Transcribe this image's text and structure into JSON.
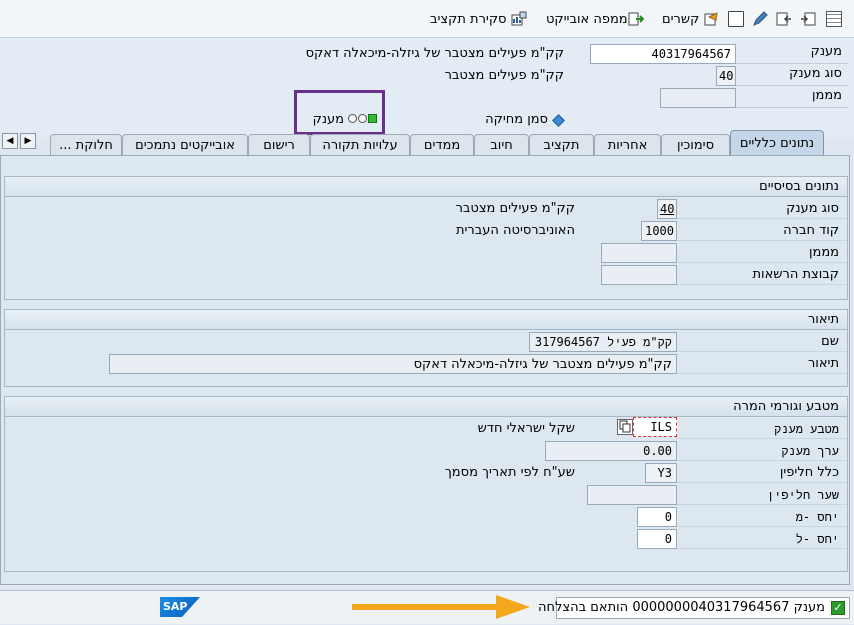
{
  "toolbar": {
    "relationships": "קשרים",
    "object_map": "ממפה אובייקט",
    "budget_review": "סקירת תקציב"
  },
  "header": {
    "customer_label": "מענק",
    "customer_value": "40317964567",
    "customer_desc": "קק\"מ פעילים מצטבר של גיזלה-מיכאלה דאקס",
    "type_label": "סוג מענק",
    "type_value": "40",
    "type_desc": "קק\"מ פעילים מצטבר",
    "funder_label": "מממן",
    "funder_value": "",
    "delete_flag_label": "סמן מחיקה",
    "status_label": "מענק"
  },
  "tabs": [
    {
      "label": "נתונים כלליים"
    },
    {
      "label": "סימוכין"
    },
    {
      "label": "אחריות"
    },
    {
      "label": "תקציב"
    },
    {
      "label": "חיוב"
    },
    {
      "label": "ממדים"
    },
    {
      "label": "עלויות תקורה"
    },
    {
      "label": "רישום"
    },
    {
      "label": "אובייקטים נתמכים"
    },
    {
      "label": "חלוקת ..."
    }
  ],
  "basic": {
    "title": "נתונים בסיסיים",
    "type_label": "סוג מענק",
    "type_value": "40",
    "type_desc": "קק\"מ פעילים מצטבר",
    "company_label": "קוד חברה",
    "company_value": "1000",
    "company_desc": "האוניברסיטה העברית",
    "funder_label": "מממן",
    "funder_value": "",
    "auth_group_label": "קבוצת הרשאות",
    "auth_group_value": ""
  },
  "description": {
    "title": "תיאור",
    "name_label": "שם",
    "name_value": "קק\"מ פעיל 317964567",
    "desc_label": "תיאור",
    "desc_value": "קק\"מ פעילים מצטבר של גיזלה-מיכאלה דאקס"
  },
  "currency": {
    "title": "מטבע וגורמי המרה",
    "currency_label": "מטבע מענק",
    "currency_value": "ILS",
    "currency_desc": "שקל ישראלי חדש",
    "value_label": "ערך מענק",
    "value_value": "0.00",
    "rule_label": "כלל חליפין",
    "rule_value": "Y3",
    "rule_desc": "שע\"ח לפי תאריך מסמך",
    "rate_label": "שער חליפין",
    "rate_value": "",
    "from_ratio_label": "יחס -מ",
    "from_ratio_value": "0",
    "to_ratio_label": "יחס -ל",
    "to_ratio_value": "0"
  },
  "status": {
    "message": "מענק 0000000040317964567 הותאם בהצלחה",
    "logo": "SAP"
  },
  "colors": {
    "highlight_box": "#6a2f8a",
    "arrow": "#f2a71c",
    "success": "#2e9b2e"
  }
}
